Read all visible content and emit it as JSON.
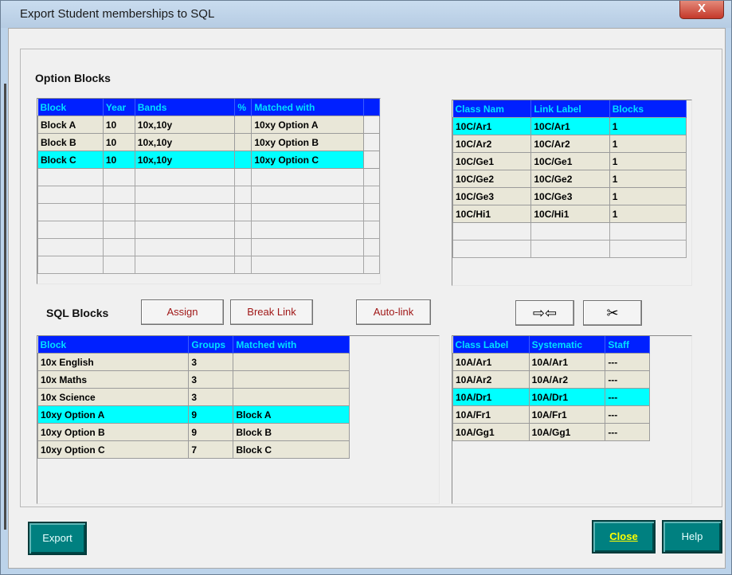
{
  "window": {
    "title": "Export Student memberships to SQL",
    "close_glyph": "X"
  },
  "option_blocks": {
    "label": "Option Blocks",
    "columns": [
      "Block",
      "Year",
      "Bands",
      "%",
      "Matched with"
    ],
    "rows": [
      [
        "Block A",
        "10",
        "10x,10y",
        "",
        "10xy Option A"
      ],
      [
        "Block B",
        "10",
        "10x,10y",
        "",
        "10xy Option B"
      ],
      [
        "Block C",
        "10",
        "10x,10y",
        "",
        "10xy Option C"
      ]
    ],
    "selected_index": 2
  },
  "class_links": {
    "columns": [
      "Class Nam",
      "Link Label",
      "Blocks"
    ],
    "rows": [
      [
        "10C/Ar1",
        "10C/Ar1",
        "1"
      ],
      [
        "10C/Ar2",
        "10C/Ar2",
        "1"
      ],
      [
        "10C/Ge1",
        "10C/Ge1",
        "1"
      ],
      [
        "10C/Ge2",
        "10C/Ge2",
        "1"
      ],
      [
        "10C/Ge3",
        "10C/Ge3",
        "1"
      ],
      [
        "10C/Hi1",
        "10C/Hi1",
        "1"
      ]
    ],
    "selected_index": 0
  },
  "sql_blocks": {
    "label": "SQL Blocks",
    "assign_label": "Assign",
    "break_link_label": "Break Link",
    "auto_link_label": "Auto-link",
    "columns": [
      "Block",
      "Groups",
      "Matched with"
    ],
    "rows": [
      [
        "10x English",
        "3",
        ""
      ],
      [
        "10x Maths",
        "3",
        ""
      ],
      [
        "10x Science",
        "3",
        ""
      ],
      [
        "10xy Option A",
        "9",
        "Block A"
      ],
      [
        "10xy Option B",
        "9",
        "Block B"
      ],
      [
        "10xy Option C",
        "7",
        "Block C"
      ]
    ],
    "selected_index": 3
  },
  "swap_button": {
    "icon": "swap-arrows-icon",
    "glyph": "⇨⇦"
  },
  "cut_button": {
    "icon": "scissors-icon",
    "glyph": "✂"
  },
  "sql_classes": {
    "columns": [
      "Class Label",
      "Systematic",
      "Staff"
    ],
    "rows": [
      [
        "10A/Ar1",
        "10A/Ar1",
        "---"
      ],
      [
        "10A/Ar2",
        "10A/Ar2",
        "---"
      ],
      [
        "10A/Dr1",
        "10A/Dr1",
        "---"
      ],
      [
        "10A/Fr1",
        "10A/Fr1",
        "---"
      ],
      [
        "10A/Gg1",
        "10A/Gg1",
        "---"
      ]
    ],
    "selected_index": 2
  },
  "footer": {
    "export_label": "Export",
    "close_label": "Close",
    "help_label": "Help"
  },
  "colors": {
    "header_bg": "#0020ff",
    "header_text": "#00e0ff",
    "selected_row": "#00ffff",
    "cell_bg": "#e9e7d8",
    "teal_button": "#008080"
  }
}
